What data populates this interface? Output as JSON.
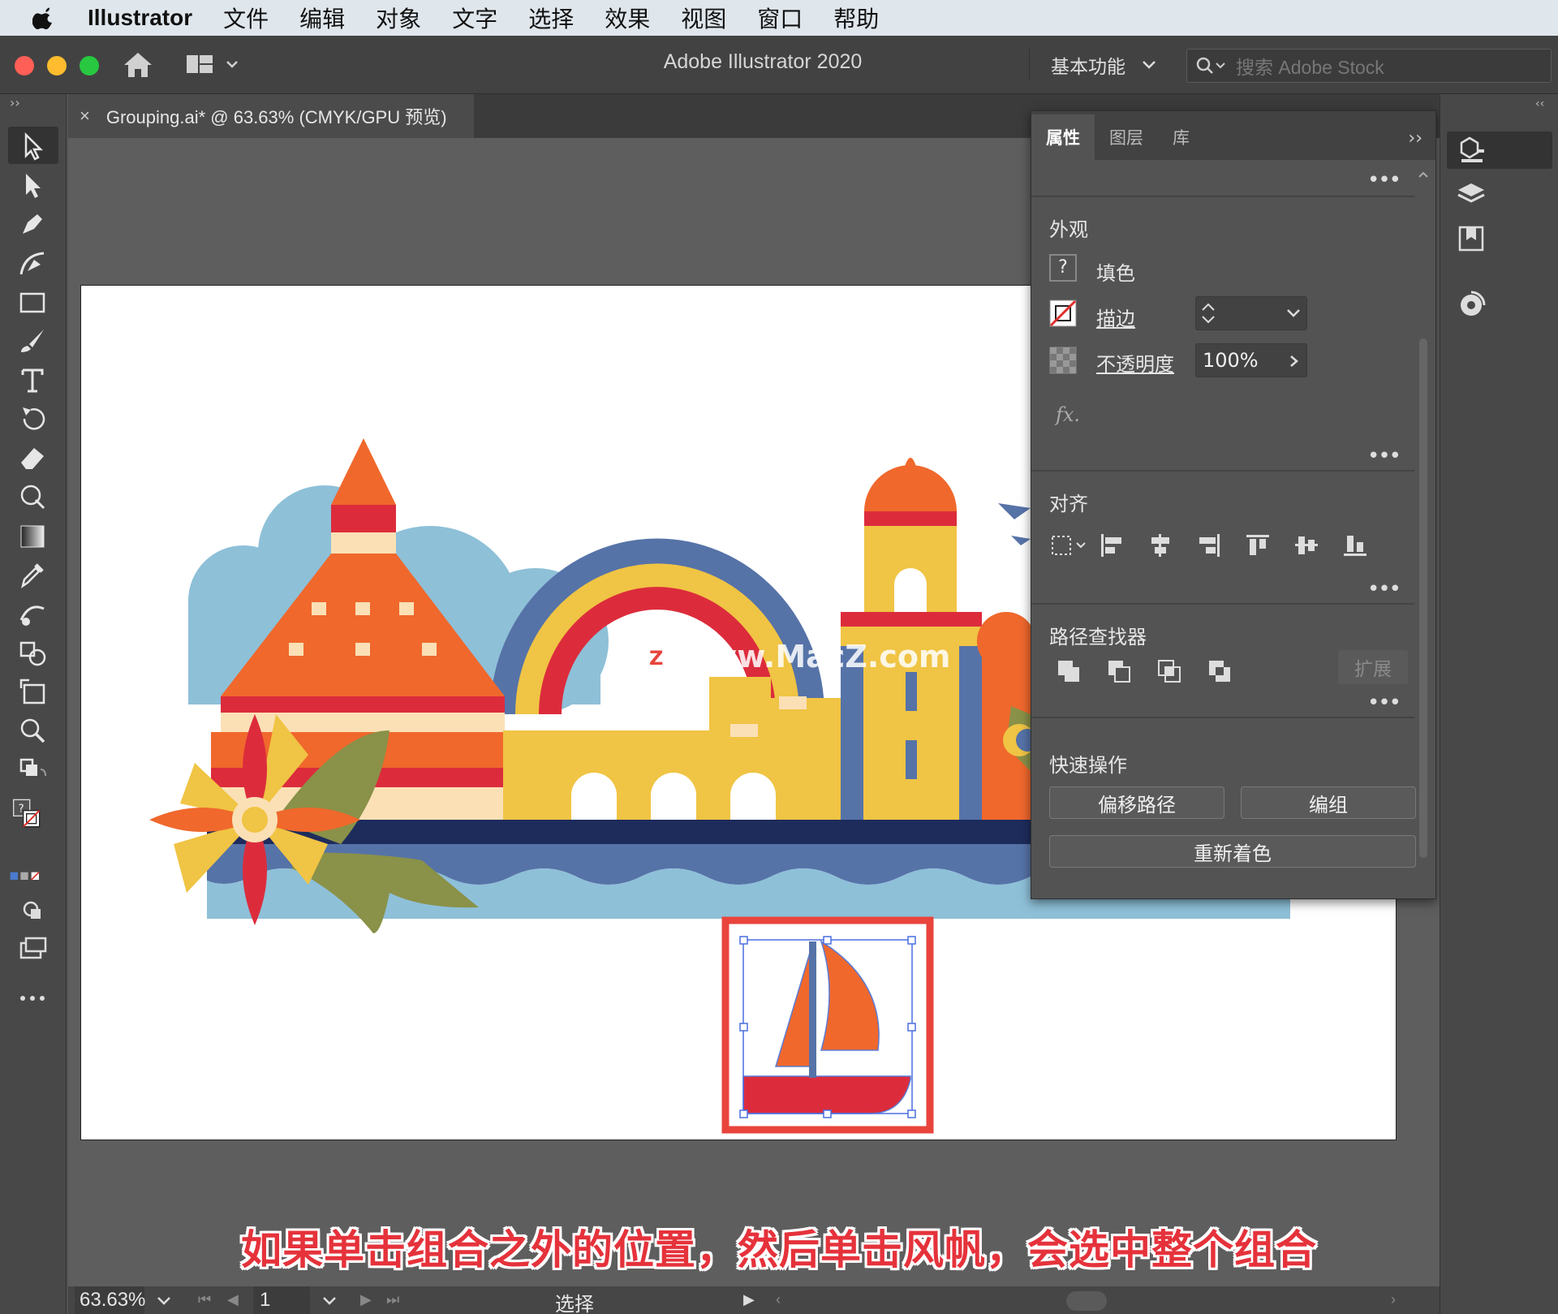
{
  "menubar": {
    "app_name": "Illustrator",
    "items": [
      "文件",
      "编辑",
      "对象",
      "文字",
      "选择",
      "效果",
      "视图",
      "窗口",
      "帮助"
    ]
  },
  "titlebar": {
    "title": "Adobe Illustrator 2020",
    "workspace_label": "基本功能",
    "search_placeholder": "搜索 Adobe Stock"
  },
  "document": {
    "tab_label": "Grouping.ai* @ 63.63% (CMYK/GPU 预览)",
    "close_glyph": "×"
  },
  "watermark": {
    "logo_letter": "Z",
    "text": "www.MacZ.com"
  },
  "properties_panel": {
    "tabs": [
      "属性",
      "图层",
      "库"
    ],
    "collapse_glyph": "››",
    "more_glyph": "•••",
    "appearance": {
      "title": "外观",
      "fill_label": "填色",
      "fill_swatch_glyph": "?",
      "stroke_label": "描边",
      "opacity_label": "不透明度",
      "opacity_value": "100%",
      "fx_label": "fx."
    },
    "align": {
      "title": "对齐"
    },
    "pathfinder": {
      "title": "路径查找器",
      "expand_label": "扩展"
    },
    "quick_actions": {
      "title": "快速操作",
      "offset_path": "偏移路径",
      "group": "编组",
      "recolor": "重新着色"
    }
  },
  "statusbar": {
    "zoom": "63.63%",
    "page": "1",
    "current_tool": "选择"
  },
  "caption": "如果单击组合之外的位置，然后单击风帆，会选中整个组合",
  "colors": {
    "accent_red": "#dc2c3c",
    "orange": "#f0682c",
    "yellow": "#f0c444",
    "navy": "#1e2c5c",
    "blue": "#5673a8",
    "light_blue": "#8ec0d8",
    "olive": "#8a9148"
  }
}
